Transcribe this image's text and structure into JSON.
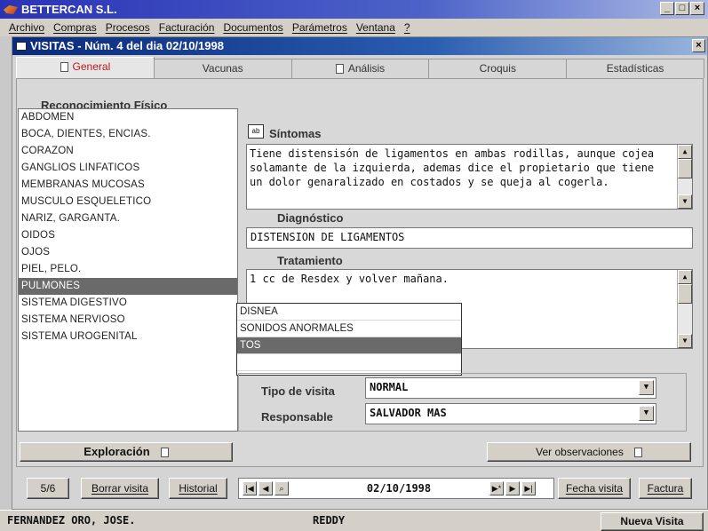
{
  "app": {
    "title": "BETTERCAN S.L.",
    "min": "_",
    "max": "□",
    "close": "×"
  },
  "menu": [
    "Archivo",
    "Compras",
    "Procesos",
    "Facturación",
    "Documentos",
    "Parámetros",
    "Ventana",
    "?"
  ],
  "child": {
    "title": "VISITAS - Núm. 4 del dia 02/10/1998",
    "close": "×"
  },
  "tabs": [
    {
      "label": "General",
      "active": true,
      "icon": "doc-icon"
    },
    {
      "label": "Vacunas"
    },
    {
      "label": "Análisis",
      "icon": "doc-icon"
    },
    {
      "label": "Croquis"
    },
    {
      "label": "Estadísticas"
    }
  ],
  "recon": {
    "title": "Reconocimiento Físico",
    "items": [
      "ABDOMEN",
      "BOCA, DIENTES, ENCIAS.",
      "CORAZON",
      "GANGLIOS LINFATICOS",
      "MEMBRANAS MUCOSAS",
      "MUSCULO ESQUELETICO",
      "NARIZ, GARGANTA.",
      "OIDOS",
      "OJOS",
      "PIEL, PELO.",
      "PULMONES",
      "SISTEMA DIGESTIVO",
      "SISTEMA NERVIOSO",
      "SISTEMA UROGENITAL"
    ],
    "selected": "PULMONES"
  },
  "dropdown": {
    "items": [
      "DISNEA",
      "SONIDOS ANORMALES",
      "TOS",
      ""
    ],
    "selected": "TOS"
  },
  "sintomas": {
    "label": "Síntomas",
    "value": "Tiene distensisón de ligamentos en ambas rodillas, aunque cojea solamante de la izquierda, ademas dice el propietario que tiene un dolor genaralizado en costados y se queja al cogerla."
  },
  "diagnostico": {
    "label": "Diagnóstico",
    "value": "DISTENSION DE LIGAMENTOS"
  },
  "tratamiento": {
    "label": "Tratamiento",
    "value": "1 cc de Resdex y volver mañana."
  },
  "tipo_visita": {
    "label": "Tipo de visita",
    "value": "NORMAL"
  },
  "responsable": {
    "label": "Responsable",
    "value": "SALVADOR MAS"
  },
  "buttons": {
    "exploracion": "Exploración",
    "ver_observaciones": "Ver observaciones"
  },
  "bottom": {
    "record": "5/6",
    "borrar": "Borrar visita",
    "historial": "Historial",
    "date": "02/10/1998",
    "fecha_visita": "Fecha visita",
    "factura": "Factura"
  },
  "status": {
    "client": "FERNANDEZ ORO, JOSE.",
    "pet": "REDDY",
    "nueva_visita": "Nueva Visita"
  }
}
